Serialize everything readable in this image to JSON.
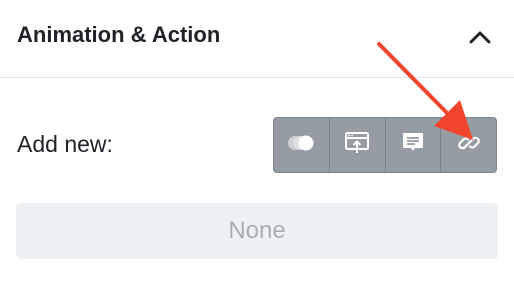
{
  "panel": {
    "title": "Animation & Action",
    "toggle_icon": "chevron-up-icon"
  },
  "add_new": {
    "label": "Add new:",
    "buttons": [
      {
        "icon": "animation-circles-icon"
      },
      {
        "icon": "screen-action-icon"
      },
      {
        "icon": "comment-icon"
      },
      {
        "icon": "link-icon"
      }
    ]
  },
  "selection": {
    "value": "None"
  },
  "colors": {
    "toolbar": "#959ca3",
    "arrow": "#f2452e",
    "muted_text": "#a7aeb5",
    "field_bg": "#eef1f3"
  }
}
